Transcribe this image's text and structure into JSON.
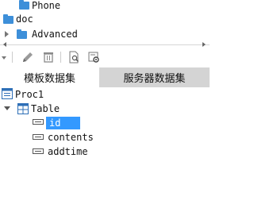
{
  "top_tree": {
    "items": [
      {
        "label": "Phone"
      },
      {
        "label": "doc"
      },
      {
        "label": "Advanced"
      }
    ]
  },
  "toolbar": {
    "buttons": [
      "menu-icon",
      "edit-icon",
      "delete-icon",
      "preview-icon",
      "settings-icon"
    ]
  },
  "tabs": [
    {
      "label": "模板数据集"
    },
    {
      "label": "服务器数据集"
    }
  ],
  "dataset_tree": {
    "proc": "Proc1",
    "table": "Table",
    "fields": [
      "id",
      "contents",
      "addtime"
    ],
    "selected_field": "id"
  }
}
